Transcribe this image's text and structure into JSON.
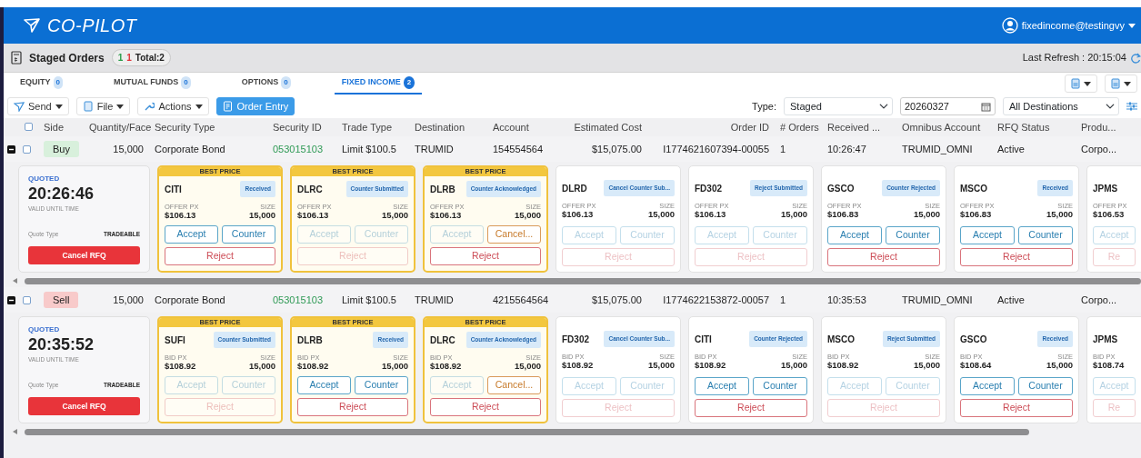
{
  "header": {
    "app_name": "CO-PILOT",
    "user": "fixedincome@testingvy"
  },
  "staged_bar": {
    "title": "Staged Orders",
    "counts": [
      {
        "text": "1",
        "color": "#2a9d4a"
      },
      {
        "text": "1",
        "color": "#e0343a"
      }
    ],
    "total": "Total:2",
    "last_refresh": "Last Refresh : 20:15:04"
  },
  "tabs": [
    {
      "label": "EQUITY",
      "count": "0",
      "selected": false
    },
    {
      "label": "MUTUAL FUNDS",
      "count": "0",
      "selected": false
    },
    {
      "label": "OPTIONS",
      "count": "0",
      "selected": false
    },
    {
      "label": "FIXED INCOME",
      "count": "2",
      "selected": true
    }
  ],
  "toolbar": [
    {
      "label": "Send",
      "kind": "menu"
    },
    {
      "label": "File",
      "kind": "menu"
    },
    {
      "label": "Actions",
      "kind": "menu"
    },
    {
      "label": "Order Entry",
      "kind": "primary"
    }
  ],
  "filters": {
    "type_label": "Type:",
    "type_value": "Staged",
    "date": "20260327",
    "destination": "All Destinations"
  },
  "table": {
    "all_checked": false,
    "columns": [
      "Side",
      "Quantity/Face",
      "Security Type",
      "Security ID",
      "Trade Type",
      "Destination",
      "Account",
      "Estimated Cost",
      "Order ID",
      "# Orders",
      "Received ...",
      "Omnibus Account",
      "RFQ Status",
      "Produ..."
    ],
    "rows": [
      {
        "expanded": true,
        "checked": false,
        "color": "#d8f0dc",
        "cells": [
          "Buy",
          "15,000",
          "Corporate Bond",
          "053015103",
          "Limit $100.5",
          "TRUMID",
          "154554564",
          "$15,075.00",
          "I1774621607394-00055",
          "1",
          "10:26:47",
          "TRUMID_OMNI",
          "Active",
          "Corpo..."
        ],
        "quote": {
          "status": "QUOTED",
          "time": "20:26:46",
          "time_label": "VALID UNTIL TIME",
          "quote_type_label": "Quote Type",
          "quote_type": "TRADEABLE",
          "cancel": "Cancel RFQ"
        },
        "responses": [
          {
            "tag": "BEST PRICE",
            "firm": "CITI",
            "status": "Received",
            "price_label": "OFFER PX",
            "price": "$106.13",
            "size_label": "SIZE",
            "size": "15,000",
            "buttons": [
              {
                "label": "Accept",
                "kind": "accept",
                "disabled": false
              },
              {
                "label": "Counter",
                "kind": "counter",
                "disabled": false
              },
              {
                "label": "Reject",
                "kind": "reject",
                "disabled": false
              }
            ]
          },
          {
            "tag": "BEST PRICE",
            "firm": "DLRC",
            "status": "Counter Submitted",
            "price_label": "OFFER PX",
            "price": "$106.13",
            "size_label": "SIZE",
            "size": "15,000",
            "buttons": [
              {
                "label": "Accept",
                "kind": "accept",
                "disabled": true
              },
              {
                "label": "Counter",
                "kind": "counter",
                "disabled": true
              },
              {
                "label": "Reject",
                "kind": "reject",
                "disabled": true
              }
            ]
          },
          {
            "tag": "BEST PRICE",
            "firm": "DLRB",
            "status": "Counter Acknowledged",
            "price_label": "OFFER PX",
            "price": "$106.13",
            "size_label": "SIZE",
            "size": "15,000",
            "buttons": [
              {
                "label": "Accept",
                "kind": "accept",
                "disabled": true
              },
              {
                "label": "Cancel...",
                "kind": "cancel",
                "disabled": false
              },
              {
                "label": "Reject",
                "kind": "reject",
                "disabled": false
              }
            ]
          },
          {
            "firm": "DLRD",
            "status": "Cancel Counter Sub...",
            "price_label": "OFFER PX",
            "price": "$106.13",
            "size_label": "SIZE",
            "size": "15,000",
            "buttons": [
              {
                "label": "Accept",
                "kind": "accept",
                "disabled": true
              },
              {
                "label": "Counter",
                "kind": "counter",
                "disabled": true
              },
              {
                "label": "Reject",
                "kind": "reject",
                "disabled": true
              }
            ]
          },
          {
            "firm": "FD302",
            "status": "Reject Submitted",
            "price_label": "OFFER PX",
            "price": "$106.13",
            "size_label": "SIZE",
            "size": "15,000",
            "buttons": [
              {
                "label": "Accept",
                "kind": "accept",
                "disabled": true
              },
              {
                "label": "Counter",
                "kind": "counter",
                "disabled": true
              },
              {
                "label": "Reject",
                "kind": "reject",
                "disabled": true
              }
            ]
          },
          {
            "firm": "GSCO",
            "status": "Counter Rejected",
            "price_label": "OFFER PX",
            "price": "$106.83",
            "size_label": "SIZE",
            "size": "15,000",
            "buttons": [
              {
                "label": "Accept",
                "kind": "accept",
                "disabled": false
              },
              {
                "label": "Counter",
                "kind": "counter",
                "disabled": false
              },
              {
                "label": "Reject",
                "kind": "reject",
                "disabled": false
              }
            ]
          },
          {
            "firm": "MSCO",
            "status": "Received",
            "price_label": "OFFER PX",
            "price": "$106.83",
            "size_label": "SIZE",
            "size": "15,000",
            "buttons": [
              {
                "label": "Accept",
                "kind": "accept",
                "disabled": false
              },
              {
                "label": "Counter",
                "kind": "counter",
                "disabled": false
              },
              {
                "label": "Reject",
                "kind": "reject",
                "disabled": false
              }
            ]
          },
          {
            "firm": "JPMS",
            "price_label": "OFFER PX",
            "price": "$106.53",
            "buttons": [
              {
                "label": "Accept",
                "kind": "accept",
                "disabled": true
              },
              {
                "label": "Re",
                "kind": "reject",
                "disabled": true
              }
            ]
          }
        ]
      },
      {
        "expanded": true,
        "checked": false,
        "color": "#f8caca",
        "cells": [
          "Sell",
          "15,000",
          "Corporate Bond",
          "053015103",
          "Limit $100.5",
          "TRUMID",
          "4215564564",
          "$15,075.00",
          "I1774622153872-00057",
          "1",
          "10:35:53",
          "TRUMID_OMNI",
          "Active",
          "Corpo..."
        ],
        "quote": {
          "status": "QUOTED",
          "time": "20:35:52",
          "time_label": "VALID UNTIL TIME",
          "quote_type_label": "Quote Type",
          "quote_type": "TRADEABLE",
          "cancel": "Cancel RFQ"
        },
        "responses": [
          {
            "tag": "BEST PRICE",
            "firm": "SUFI",
            "status": "Counter Submitted",
            "price_label": "BID PX",
            "price": "$108.92",
            "size_label": "SIZE",
            "size": "15,000",
            "buttons": [
              {
                "label": "Accept",
                "kind": "accept",
                "disabled": true
              },
              {
                "label": "Counter",
                "kind": "counter",
                "disabled": true
              },
              {
                "label": "Reject",
                "kind": "reject",
                "disabled": true
              }
            ]
          },
          {
            "tag": "BEST PRICE",
            "firm": "DLRB",
            "status": "Received",
            "price_label": "BID PX",
            "price": "$108.92",
            "size_label": "SIZE",
            "size": "15,000",
            "buttons": [
              {
                "label": "Accept",
                "kind": "accept",
                "disabled": false
              },
              {
                "label": "Counter",
                "kind": "counter",
                "disabled": false
              },
              {
                "label": "Reject",
                "kind": "reject",
                "disabled": false
              }
            ]
          },
          {
            "tag": "BEST PRICE",
            "firm": "DLRC",
            "status": "Counter Acknowledged",
            "price_label": "BID PX",
            "price": "$108.92",
            "size_label": "SIZE",
            "size": "15,000",
            "buttons": [
              {
                "label": "Accept",
                "kind": "accept",
                "disabled": true
              },
              {
                "label": "Cancel...",
                "kind": "cancel",
                "disabled": false
              },
              {
                "label": "Reject",
                "kind": "reject",
                "disabled": false
              }
            ]
          },
          {
            "firm": "FD302",
            "status": "Cancel Counter Sub...",
            "price_label": "BID PX",
            "price": "$108.92",
            "size_label": "SIZE",
            "size": "15,000",
            "buttons": [
              {
                "label": "Accept",
                "kind": "accept",
                "disabled": true
              },
              {
                "label": "Counter",
                "kind": "counter",
                "disabled": true
              },
              {
                "label": "Reject",
                "kind": "reject",
                "disabled": true
              }
            ]
          },
          {
            "firm": "CITI",
            "status": "Counter Rejected",
            "price_label": "BID PX",
            "price": "$108.92",
            "size_label": "SIZE",
            "size": "15,000",
            "buttons": [
              {
                "label": "Accept",
                "kind": "accept",
                "disabled": false
              },
              {
                "label": "Counter",
                "kind": "counter",
                "disabled": false
              },
              {
                "label": "Reject",
                "kind": "reject",
                "disabled": false
              }
            ]
          },
          {
            "firm": "MSCO",
            "status": "Reject Submitted",
            "price_label": "BID PX",
            "price": "$108.92",
            "size_label": "SIZE",
            "size": "15,000",
            "buttons": [
              {
                "label": "Accept",
                "kind": "accept",
                "disabled": true
              },
              {
                "label": "Counter",
                "kind": "counter",
                "disabled": true
              },
              {
                "label": "Reject",
                "kind": "reject",
                "disabled": true
              }
            ]
          },
          {
            "firm": "GSCO",
            "status": "Received",
            "price_label": "BID PX",
            "price": "$108.64",
            "size_label": "SIZE",
            "size": "15,000",
            "buttons": [
              {
                "label": "Accept",
                "kind": "accept",
                "disabled": false
              },
              {
                "label": "Counter",
                "kind": "counter",
                "disabled": false
              },
              {
                "label": "Reject",
                "kind": "reject",
                "disabled": false
              }
            ]
          },
          {
            "firm": "JPMS",
            "price_label": "BID PX",
            "price": "$108.74",
            "buttons": [
              {
                "label": "Accept",
                "kind": "accept",
                "disabled": true
              },
              {
                "label": "Re",
                "kind": "reject",
                "disabled": true
              }
            ]
          }
        ]
      }
    ]
  }
}
